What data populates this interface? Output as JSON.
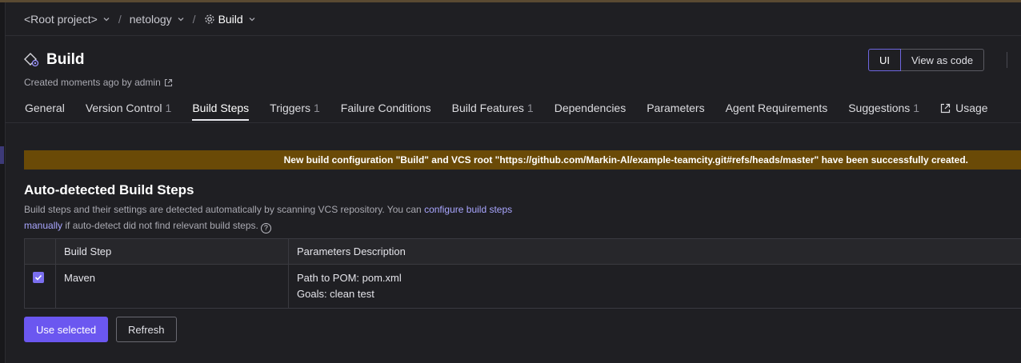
{
  "breadcrumbs": [
    {
      "label": "<Root project>",
      "has_chevron": true
    },
    {
      "label": "netology",
      "has_chevron": true
    },
    {
      "label": "Build",
      "icon": "gear-icon",
      "has_chevron": true
    }
  ],
  "breadcrumb_separator": "/",
  "header": {
    "title": "Build",
    "title_icon": "build-config-icon",
    "subtitle": "Created moments ago by admin",
    "subtitle_icon": "external-link-icon"
  },
  "view_switch": {
    "ui_label": "UI",
    "code_label": "View as code",
    "active": "UI"
  },
  "tabs": [
    {
      "label": "General",
      "count": ""
    },
    {
      "label": "Version Control",
      "count": "1"
    },
    {
      "label": "Build Steps",
      "count": "",
      "active": true
    },
    {
      "label": "Triggers",
      "count": "1"
    },
    {
      "label": "Failure Conditions",
      "count": ""
    },
    {
      "label": "Build Features",
      "count": "1"
    },
    {
      "label": "Dependencies",
      "count": ""
    },
    {
      "label": "Parameters",
      "count": ""
    },
    {
      "label": "Agent Requirements",
      "count": ""
    },
    {
      "label": "Suggestions",
      "count": "1"
    },
    {
      "label": "Usage",
      "count": "",
      "icon": "external-link-icon"
    }
  ],
  "banner": {
    "message": "New build configuration \"Build\" and VCS root \"https://github.com/Markin-Al/example-teamcity.git#refs/heads/master\" have been successfully created."
  },
  "section": {
    "title": "Auto-detected Build Steps",
    "desc_text1": "Build steps and their settings are detected automatically by scanning VCS repository. You can ",
    "desc_link1": "configure build steps",
    "desc_link2": "manually",
    "desc_text2": " if auto-detect did not find relevant build steps.",
    "help_glyph": "?"
  },
  "table": {
    "columns": [
      "Build Step",
      "Parameters Description"
    ],
    "rows": [
      {
        "checked": true,
        "step": "Maven",
        "params": [
          "Path to POM: pom.xml",
          "Goals: clean test"
        ]
      }
    ]
  },
  "buttons": {
    "use_selected": "Use selected",
    "refresh": "Refresh"
  },
  "colors": {
    "background": "#1f1f23",
    "accent": "#6b57f0",
    "banner": "#6a4a07",
    "link": "#a9a6ff"
  }
}
